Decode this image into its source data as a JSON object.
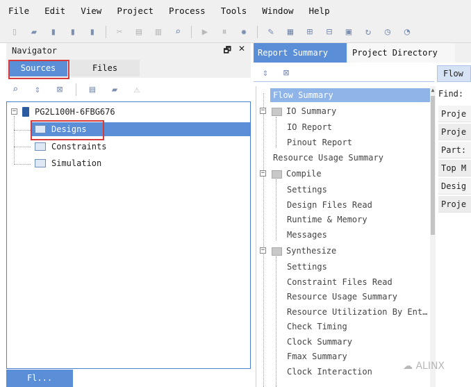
{
  "menu": [
    "File",
    "Edit",
    "View",
    "Project",
    "Process",
    "Tools",
    "Window",
    "Help"
  ],
  "toolbar_icons": [
    "new-file",
    "open-folder",
    "save",
    "save-all",
    "save-as",
    "cut",
    "copy",
    "paste",
    "find",
    "run",
    "pause",
    "settings",
    "edit",
    "report",
    "schematic",
    "network",
    "chip",
    "refresh",
    "clock",
    "more"
  ],
  "navigator": {
    "title": "Navigator",
    "float_label": "🗗",
    "close_label": "✕",
    "tabs": {
      "sources": "Sources",
      "files": "Files"
    },
    "tree": {
      "project": "PG2L100H-6FBG676",
      "items": [
        "Designs",
        "Constraints",
        "Simulation"
      ]
    },
    "bottom_tab": "Fl..."
  },
  "report_tabs": {
    "report_summary": "Report Summary",
    "project_directory": "Project Directory"
  },
  "report_tree": [
    {
      "label": "Flow Summary"
    },
    {
      "label": "IO Summary"
    },
    {
      "label": "IO Report"
    },
    {
      "label": "Pinout Report"
    },
    {
      "label": "Resource Usage Summary"
    },
    {
      "label": "Compile"
    },
    {
      "label": "Settings"
    },
    {
      "label": "Design Files Read"
    },
    {
      "label": "Runtime & Memory"
    },
    {
      "label": "Messages"
    },
    {
      "label": "Synthesize"
    },
    {
      "label": "Settings"
    },
    {
      "label": "Constraint Files Read"
    },
    {
      "label": "Resource Usage Summary"
    },
    {
      "label": "Resource Utilization By Ent…"
    },
    {
      "label": "Check Timing"
    },
    {
      "label": "Clock Summary"
    },
    {
      "label": "Fmax Summary"
    },
    {
      "label": "Clock Interaction"
    }
  ],
  "flow_panel": {
    "tab": "Flow",
    "find": "Find:",
    "rows": [
      "Proje",
      "Proje",
      "Part:",
      "Top M",
      "Desig",
      "Proje"
    ]
  },
  "watermark": "ALINX",
  "colors": {
    "accent": "#5a8fd8",
    "highlight": "#d63a3a"
  }
}
